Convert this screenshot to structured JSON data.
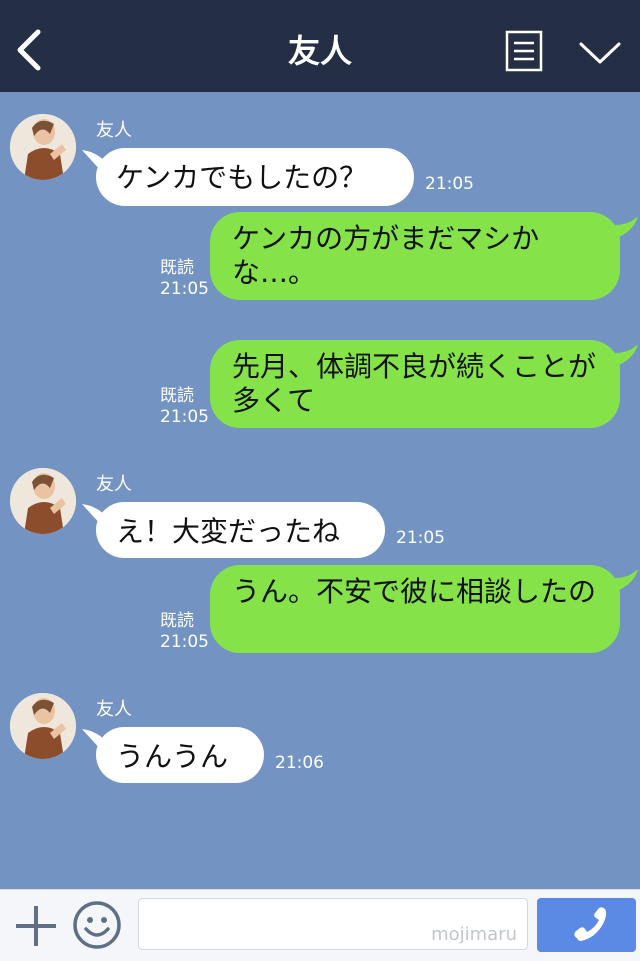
{
  "header": {
    "title": "友人"
  },
  "messages": [
    {
      "sender": "友人",
      "text": "ケンカでもしたの？",
      "time": "21:05"
    },
    {
      "text": "ケンカの方がまだマシかな…。",
      "read": "既読",
      "time": "21:05"
    },
    {
      "text": "先月、体調不良が続くことが多くて",
      "read": "既読",
      "time": "21:05"
    },
    {
      "sender": "友人",
      "text": "え！大変だったね",
      "time": "21:05"
    },
    {
      "text": "うん。不安で彼に相談したの",
      "read": "既読",
      "time": "21:05"
    },
    {
      "sender": "友人",
      "text": "うんうん",
      "time": "21:06"
    }
  ],
  "footer": {
    "watermark": "mojimaru"
  },
  "colors": {
    "header_bg": "#242e45",
    "chat_bg": "#7393c3",
    "incoming_bubble": "#ffffff",
    "outgoing_bubble": "#85e249",
    "call_button": "#5a8ae4"
  },
  "icons": [
    "back-icon",
    "menu-icon",
    "chevron-down-icon",
    "avatar",
    "plus-icon",
    "emoji-icon",
    "phone-icon"
  ]
}
